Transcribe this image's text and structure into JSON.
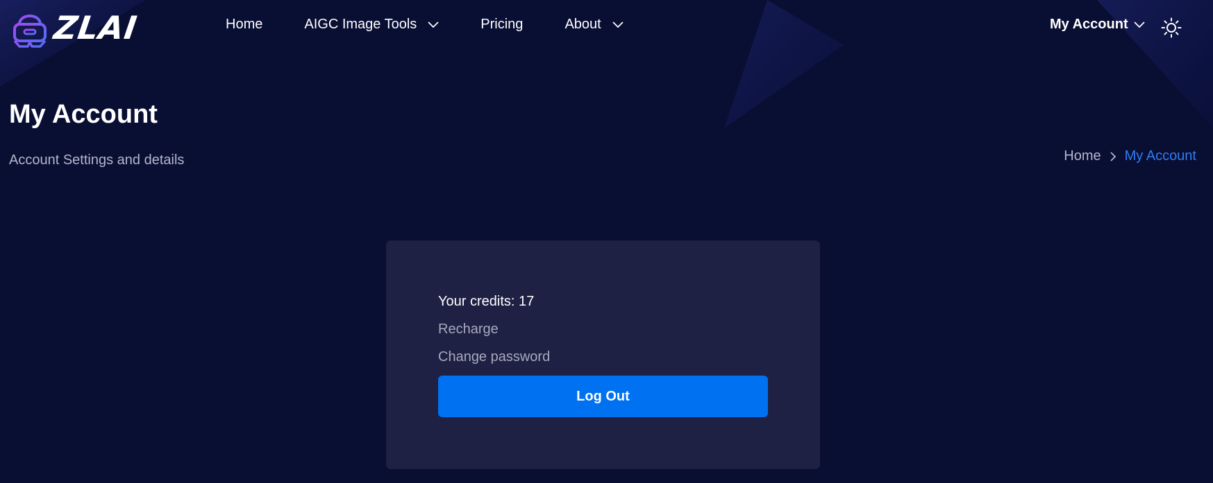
{
  "brand": {
    "name": "ZLAI",
    "logo_icon": "vr-headset-icon"
  },
  "nav": {
    "items": [
      {
        "label": "Home",
        "has_dropdown": false
      },
      {
        "label": "AIGC Image Tools",
        "has_dropdown": true
      },
      {
        "label": "Pricing",
        "has_dropdown": false
      },
      {
        "label": "About",
        "has_dropdown": true
      }
    ],
    "account_label": "My Account",
    "theme_icon": "sun-icon"
  },
  "page": {
    "title": "My Account",
    "subtitle": "Account Settings and details"
  },
  "breadcrumb": {
    "home": "Home",
    "current": "My Account"
  },
  "account_card": {
    "credits_label": "Your credits: 17",
    "recharge_label": "Recharge",
    "change_password_label": "Change password",
    "logout_label": "Log Out"
  },
  "colors": {
    "background": "#090e33",
    "card": "#1e2144",
    "accent": "#0071f1",
    "breadcrumb_active": "#2f7ef5",
    "muted_text": "#a7aabf"
  }
}
